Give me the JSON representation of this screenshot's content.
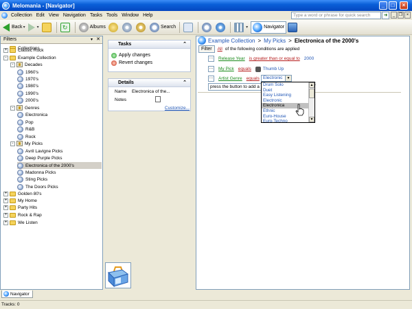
{
  "window": {
    "title": "Melomania - [Navigator]"
  },
  "menu": [
    "Collection",
    "Edit",
    "View",
    "Navigation",
    "Tasks",
    "Tools",
    "Window",
    "Help"
  ],
  "quick_search": {
    "placeholder": "Type a word or phrase for quick search"
  },
  "toolbar": {
    "back": "Back",
    "albums": "Albums",
    "search": "Search",
    "navigator": "Navigator"
  },
  "filters": {
    "title": "Filters",
    "items": [
      {
        "label": "Collections",
        "level": 0,
        "icon": "folder-icon"
      },
      {
        "label": "Classic Rock",
        "level": 0,
        "icon": "folder-icon",
        "expander": "+"
      },
      {
        "label": "Example Collection",
        "level": 0,
        "icon": "folder-icon",
        "expander": "-"
      },
      {
        "label": "Decades",
        "level": 1,
        "icon": "stack-icon",
        "expander": "-"
      },
      {
        "label": "1960's",
        "level": 2,
        "icon": "playlist-icon"
      },
      {
        "label": "1970's",
        "level": 2,
        "icon": "playlist-icon"
      },
      {
        "label": "1980's",
        "level": 2,
        "icon": "playlist-icon"
      },
      {
        "label": "1990's",
        "level": 2,
        "icon": "playlist-icon"
      },
      {
        "label": "2000's",
        "level": 2,
        "icon": "playlist-icon"
      },
      {
        "label": "Genres",
        "level": 1,
        "icon": "stack-icon",
        "expander": "-"
      },
      {
        "label": "Electronica",
        "level": 2,
        "icon": "playlist-icon"
      },
      {
        "label": "Pop",
        "level": 2,
        "icon": "playlist-icon"
      },
      {
        "label": "R&B",
        "level": 2,
        "icon": "playlist-icon"
      },
      {
        "label": "Rock",
        "level": 2,
        "icon": "playlist-icon"
      },
      {
        "label": "My Picks",
        "level": 1,
        "icon": "stack-icon",
        "expander": "-"
      },
      {
        "label": "Avril Lavigne Picks",
        "level": 2,
        "icon": "playlist-icon"
      },
      {
        "label": "Deep Purple Picks",
        "level": 2,
        "icon": "playlist-icon"
      },
      {
        "label": "Electronica of the 2000's",
        "level": 2,
        "icon": "playlist-icon",
        "selected": true
      },
      {
        "label": "Madonna Picks",
        "level": 2,
        "icon": "playlist-icon"
      },
      {
        "label": "Sting Picks",
        "level": 2,
        "icon": "playlist-icon"
      },
      {
        "label": "The Doors Picks",
        "level": 2,
        "icon": "playlist-icon"
      },
      {
        "label": "Golden 80's",
        "level": 0,
        "icon": "folder-icon",
        "expander": "+"
      },
      {
        "label": "My Home",
        "level": 0,
        "icon": "folder-icon",
        "expander": "+"
      },
      {
        "label": "Party Hits",
        "level": 0,
        "icon": "folder-icon",
        "expander": "+"
      },
      {
        "label": "Rock & Rap",
        "level": 0,
        "icon": "folder-icon",
        "expander": "+"
      },
      {
        "label": "We Listen",
        "level": 0,
        "icon": "folder-icon",
        "expander": "+"
      }
    ]
  },
  "tasks": {
    "title": "Tasks",
    "apply": "Apply changes",
    "revert": "Revert changes"
  },
  "details": {
    "title": "Details",
    "name_key": "Name",
    "name_value": "Electronica of the...",
    "notes_key": "Notes",
    "customize": "Customize..."
  },
  "breadcrumb": {
    "part1": "Example Collection",
    "sep": ">",
    "part2": "My Picks",
    "current": "Electronica of the 2000's"
  },
  "filter_bar": {
    "button": "Filter",
    "all": "All",
    "text": "of the following conditions are applied"
  },
  "conditions": [
    {
      "field": "Release Year",
      "op": "is greater than or equal to",
      "value": "2000"
    },
    {
      "field": "My Pick",
      "op": "equals",
      "value": "Thumb Up"
    },
    {
      "field": "Artist Genre",
      "op": "equals",
      "value": "Electronic"
    }
  ],
  "press_hint": "press the button to add a",
  "press_tail": "ry.",
  "genre_options": [
    "Drum Solo",
    "Duet",
    "Easy Listening",
    "Electronic",
    "Electronica",
    "Ethnic",
    "Euro-House",
    "Euro-Techno"
  ],
  "genre_highlighted": "Electronica",
  "bottom_tab": "Navigator",
  "status": "Tracks: 0",
  "colors": {
    "title_bar": "#0a5fd8",
    "link": "#1f55b5",
    "field": "#1a8a1a",
    "operator": "#b51a1a"
  }
}
